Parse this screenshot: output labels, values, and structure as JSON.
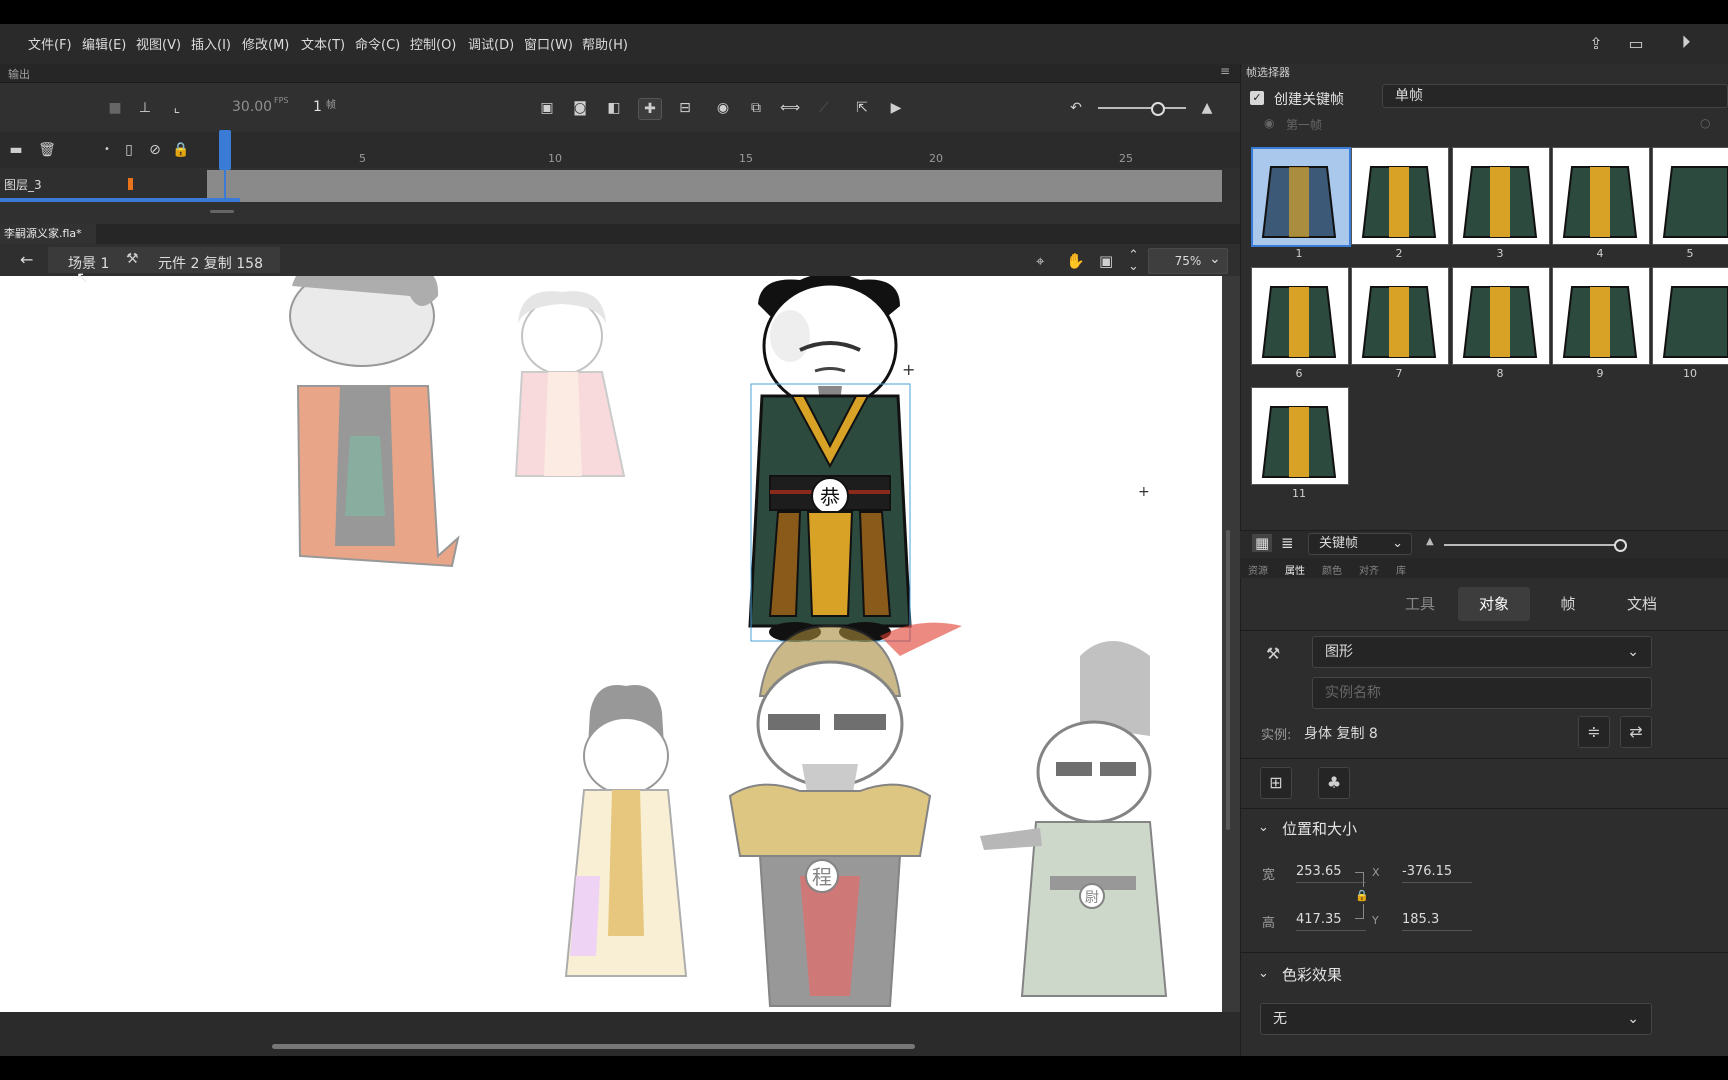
{
  "menu": [
    "文件(F)",
    "编辑(E)",
    "视图(V)",
    "插入(I)",
    "修改(M)",
    "文本(T)",
    "命令(C)",
    "控制(O)",
    "调试(D)",
    "窗口(W)",
    "帮助(H)"
  ],
  "output_panel": {
    "label": "输出"
  },
  "timeline": {
    "fps": "30.00",
    "fps_unit": "FPS",
    "current_frame": "1",
    "frame_unit": "帧",
    "ruler_ticks": [
      "5",
      "10",
      "15",
      "20",
      "25"
    ],
    "layer_name": "图层_3"
  },
  "document": {
    "tab_title": "李嗣源义家.fla*"
  },
  "editbar": {
    "scene": "场景 1",
    "symbol": "元件 2 复制 158",
    "zoom": "75%"
  },
  "stage": {
    "badge_selected": "恭",
    "badge_general": "程",
    "badge_right": "尉"
  },
  "frame_picker": {
    "title": "帧选择器",
    "create_keyframe_label": "创建关键帧",
    "create_keyframe_checked": true,
    "mode_value": "单帧",
    "first_frame_label": "第一帧",
    "frames": [
      "1",
      "2",
      "3",
      "4",
      "5",
      "6",
      "7",
      "8",
      "9",
      "10",
      "11"
    ],
    "selected_frame": "1",
    "view_select": "关键帧"
  },
  "panel_tabs": [
    "资源",
    "属性",
    "颜色",
    "对齐",
    "库"
  ],
  "properties": {
    "tabs": [
      "工具",
      "对象",
      "帧",
      "文档"
    ],
    "active_tab": "对象",
    "symbol_type": "图形",
    "instance_name_placeholder": "实例名称",
    "instance_label": "实例:",
    "instance_value": "身体 复制 8",
    "position_section": "位置和大小",
    "width_label": "宽",
    "width_value": "253.65",
    "height_label": "高",
    "height_value": "417.35",
    "x_label": "X",
    "x_value": "-376.15",
    "y_label": "Y",
    "y_value": "185.3",
    "color_section": "色彩效果",
    "color_effect_value": "无"
  },
  "colors": {
    "accent": "#3a7bd5",
    "robe_green": "#2d4a3e",
    "gold": "#d8a227"
  }
}
